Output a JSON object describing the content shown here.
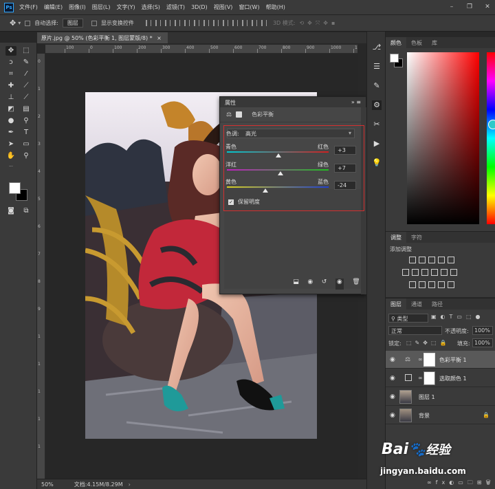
{
  "menubar": {
    "logo": "Ps",
    "items": [
      "文件(F)",
      "编辑(E)",
      "图像(I)",
      "图层(L)",
      "文字(Y)",
      "选择(S)",
      "滤镜(T)",
      "3D(D)",
      "视图(V)",
      "窗口(W)",
      "帮助(H)"
    ]
  },
  "options": {
    "auto_select_label": "自动选择:",
    "auto_select_value": "图层",
    "show_transform_label": "显示变换控件",
    "mode_3d_label": "3D 模式:"
  },
  "document": {
    "tab_title": "原片.jpg @ 50% (色彩平衡 1, 图层蒙版/8) *",
    "close": "×"
  },
  "ruler": {
    "h_labels": [
      "100",
      "0",
      "100",
      "200",
      "300",
      "400",
      "500",
      "600",
      "700",
      "800",
      "900",
      "1000",
      "1100"
    ],
    "v_labels": [
      "0",
      "1",
      "2",
      "3",
      "4",
      "5",
      "6",
      "7",
      "8",
      "9",
      "1",
      "1",
      "1",
      "1",
      "1"
    ]
  },
  "status": {
    "zoom": "50%",
    "doc_info": "文档:4.15M/8.29M"
  },
  "properties": {
    "panel_title": "属性",
    "title": "色彩平衡",
    "tone_label": "色调:",
    "tone_value": "高光",
    "sliders": [
      {
        "left": "青色",
        "right": "红色",
        "value": "+3",
        "pos": 0.51,
        "colors": [
          "#00c8d0",
          "#d02020"
        ]
      },
      {
        "left": "洋红",
        "right": "绿色",
        "value": "+7",
        "pos": 0.53,
        "colors": [
          "#c020c0",
          "#20c020"
        ]
      },
      {
        "left": "黄色",
        "right": "蓝色",
        "value": "-24",
        "pos": 0.38,
        "colors": [
          "#d8d020",
          "#2040d0"
        ]
      }
    ],
    "preserve_label": "保留明度"
  },
  "color_panel": {
    "tabs": [
      "颜色",
      "色板",
      "库"
    ]
  },
  "adjust_panel": {
    "tabs": [
      "调整",
      "字符"
    ],
    "add_label": "添加调整"
  },
  "layers_panel": {
    "tabs": [
      "图层",
      "通道",
      "路径"
    ],
    "filter_kind": "类型",
    "blend_mode": "正常",
    "opacity_label": "不透明度:",
    "opacity_value": "100%",
    "lock_label": "锁定:",
    "fill_label": "填充:",
    "fill_value": "100%",
    "layers": [
      {
        "name": "色彩平衡 1",
        "kind": "adjustment",
        "selected": true
      },
      {
        "name": "选取颜色 1",
        "kind": "adjustment",
        "selected": false
      },
      {
        "name": "图层 1",
        "kind": "photo",
        "selected": false
      },
      {
        "name": "背景",
        "kind": "photo",
        "selected": false
      }
    ]
  },
  "watermark": {
    "brand": "Bai",
    "brand2": "经验",
    "url": "jingyan.baidu.com"
  }
}
